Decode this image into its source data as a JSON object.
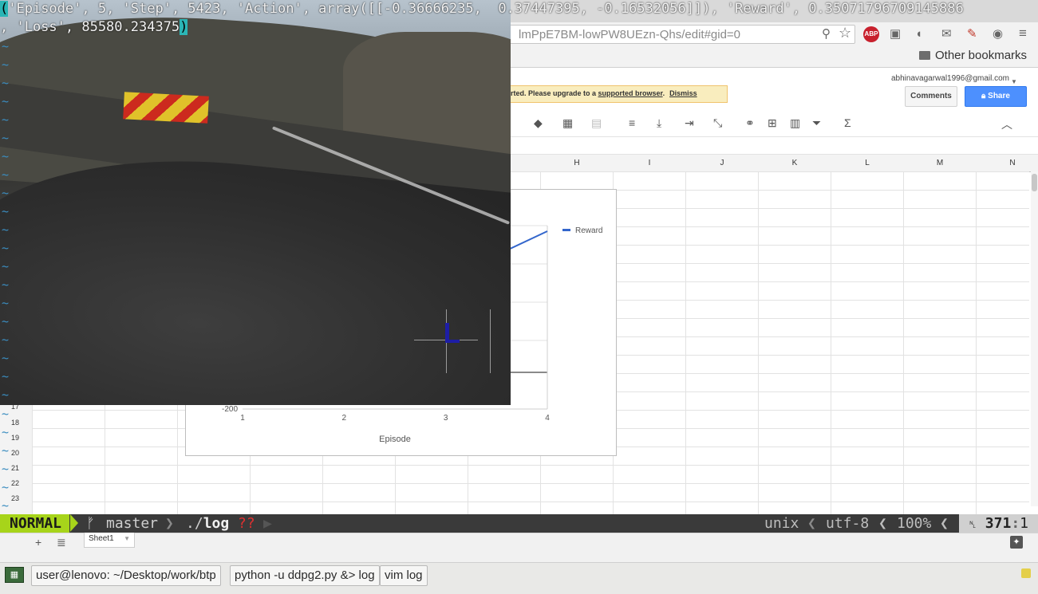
{
  "browser": {
    "url": "lmPpE7BM-lowPW8UEzn-Qhs/edit#gid=0",
    "bookmarks_label": "Other bookmarks",
    "abp_label": "ABP",
    "account_email": "abhinavagarwal1996@gmail.com",
    "warning": {
      "text": "rted. Please upgrade to a ",
      "link": "supported browser",
      "after": ".",
      "dismiss": "Dismiss"
    },
    "comments_label": "Comments",
    "share_label": "Share"
  },
  "sheet": {
    "columns": [
      "H",
      "I",
      "J",
      "K",
      "L",
      "M",
      "N"
    ],
    "rows": [
      "17",
      "18",
      "19",
      "20",
      "21",
      "22",
      "23"
    ],
    "tab_name": "Sheet1",
    "add_sheet_glyph": "+",
    "sheet_list_glyph": "≣",
    "explore_glyph": "✦"
  },
  "chart_data": {
    "type": "line",
    "x": [
      1,
      2,
      3,
      4
    ],
    "x_ticks": [
      "1",
      "2",
      "3",
      "4"
    ],
    "y_tick_visible": "-200",
    "xlabel": "Episode",
    "ylabel": "",
    "series": [
      {
        "name": "Reward",
        "color": "#3366cc"
      }
    ],
    "legend": "right"
  },
  "vim": {
    "line1_open": "(",
    "line1_body": "'Episode', 5, 'Step', 5423, 'Action', array([[-0.36666235,  0.37447395, -0.16532056]]), 'Reward', 0.35071796709145886",
    "line2_body": ", 'Loss', 85580.234375",
    "line2_close": ")",
    "tilde": "~",
    "mode": "NORMAL",
    "branch_glyph": "ᚠ",
    "branch": "master",
    "path_prefix": "./",
    "path_file": "log",
    "modified_flag": "??",
    "fileformat": "unix",
    "encoding": "utf-8",
    "percent": "100%",
    "line_glyph": "␤",
    "line_num": "371",
    "col_sep": ":",
    "col_num": "1",
    "sep_glyph": "❮"
  },
  "taskbar": {
    "items": [
      {
        "label": "user@lenovo: ~/Desktop/work/btp"
      },
      {
        "label": "python -u ddpg2.py &> log"
      },
      {
        "label": "vim log"
      }
    ]
  }
}
